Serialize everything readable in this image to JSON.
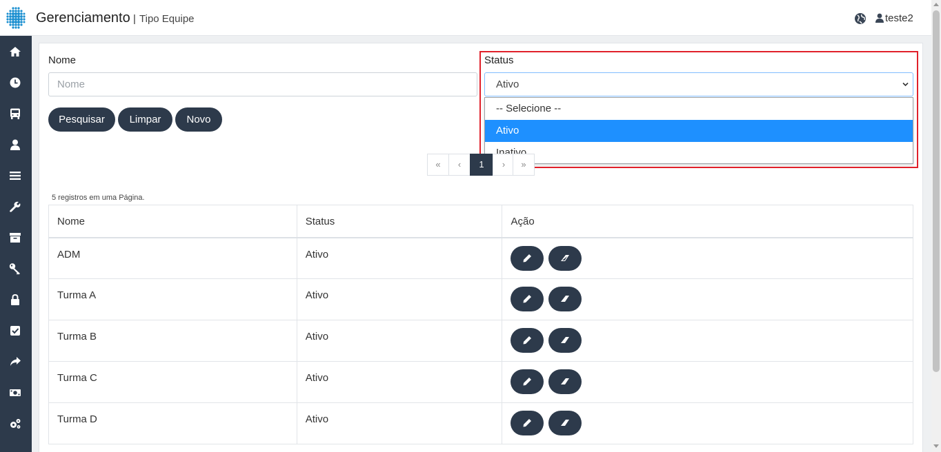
{
  "header": {
    "title": "Gerenciamento",
    "separator": "|",
    "subtitle": "Tipo Equipe",
    "user": "teste2"
  },
  "sidebar": {
    "icons": [
      "home-icon",
      "clock-icon",
      "bus-icon",
      "user-icon",
      "menu-icon",
      "wrench-icon",
      "archive-icon",
      "key-icon",
      "lock-icon",
      "check-square-icon",
      "share-icon",
      "money-icon",
      "cogs-icon"
    ]
  },
  "form": {
    "nome_label": "Nome",
    "nome_placeholder": "Nome",
    "nome_value": "",
    "status_label": "Status",
    "status_value": "Ativo",
    "status_options": [
      "-- Selecione --",
      "Ativo",
      "Inativo"
    ],
    "status_selected_index": 1
  },
  "buttons": {
    "search": "Pesquisar",
    "clear": "Limpar",
    "new": "Novo"
  },
  "pagination": {
    "first": "«",
    "prev": "‹",
    "current": "1",
    "next": "›",
    "last": "»"
  },
  "table": {
    "count_text": "5 registros em uma Página.",
    "headers": [
      "Nome",
      "Status",
      "Ação"
    ],
    "rows": [
      {
        "nome": "ADM",
        "status": "Ativo"
      },
      {
        "nome": "Turma A",
        "status": "Ativo"
      },
      {
        "nome": "Turma B",
        "status": "Ativo"
      },
      {
        "nome": "Turma C",
        "status": "Ativo"
      },
      {
        "nome": "Turma D",
        "status": "Ativo"
      }
    ]
  },
  "colors": {
    "sidebar": "#2d3a4b",
    "button": "#2d3a4b",
    "selected_option": "#1e90ff",
    "highlight": "#e0202a"
  }
}
